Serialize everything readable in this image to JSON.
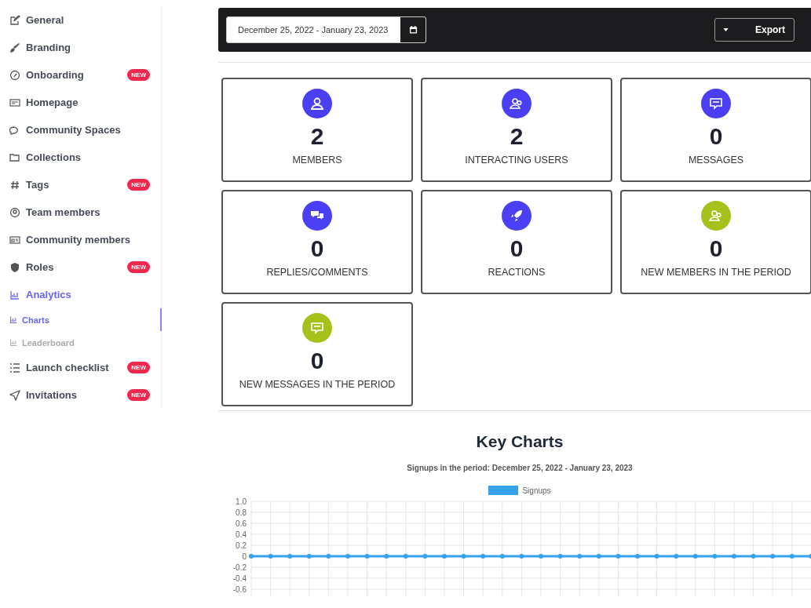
{
  "sidebar": {
    "items": [
      {
        "label": "General",
        "selected": false
      },
      {
        "label": "Branding",
        "selected": false
      },
      {
        "label": "Onboarding",
        "selected": false,
        "badge": "NEW"
      },
      {
        "label": "Homepage",
        "selected": false
      },
      {
        "label": "Community Spaces",
        "selected": false
      },
      {
        "label": "Collections",
        "selected": false
      },
      {
        "label": "Tags",
        "selected": false,
        "badge": "NEW"
      },
      {
        "label": "Team members",
        "selected": false
      },
      {
        "label": "Community members",
        "selected": false
      },
      {
        "label": "Roles",
        "selected": false,
        "badge": "NEW"
      },
      {
        "label": "Analytics",
        "selected": true,
        "children": [
          {
            "label": "Charts",
            "selected": true
          },
          {
            "label": "Leaderboard",
            "selected": false
          }
        ]
      },
      {
        "label": "Launch checklist",
        "selected": false,
        "badge": "NEW"
      },
      {
        "label": "Invitations",
        "selected": false,
        "badge": "NEW"
      }
    ]
  },
  "toolbar": {
    "date_range": "December 25, 2022 - January 23, 2023",
    "export_button": "Export"
  },
  "stats": [
    {
      "value": "2",
      "label": "MEMBERS",
      "color": "#4a3ff2"
    },
    {
      "value": "2",
      "label": "INTERACTING USERS",
      "color": "#4a3ff2"
    },
    {
      "value": "0",
      "label": "MESSAGES",
      "color": "#4a3ff2"
    },
    {
      "value": "0",
      "label": "REPLIES/COMMENTS",
      "color": "#4a3ff2"
    },
    {
      "value": "0",
      "label": "REACTIONS",
      "color": "#4a3ff2"
    },
    {
      "value": "0",
      "label": "NEW MEMBERS IN THE PERIOD",
      "color": "#a7c11c"
    },
    {
      "value": "0",
      "label": "NEW MESSAGES IN THE PERIOD",
      "color": "#a7c11c"
    }
  ],
  "key_charts": {
    "heading": "Key Charts",
    "chart_data": {
      "type": "line",
      "title": "Signups in the period: December 25, 2022 - January 23, 2023",
      "grid": true,
      "series": [
        {
          "name": "Signups",
          "color": "#36a2eb",
          "marker": true,
          "values": [
            0,
            0,
            0,
            0,
            0,
            0,
            0,
            0,
            0,
            0,
            0,
            0,
            0,
            0,
            0,
            0,
            0,
            0,
            0,
            0,
            0,
            0,
            0,
            0,
            0,
            0,
            0,
            0,
            0,
            0
          ]
        }
      ],
      "ylim": [
        -0.6,
        1.0
      ],
      "yticks": [
        {
          "value": 1,
          "label": "1.0"
        },
        0.8,
        0.6,
        0.4,
        0.2,
        0,
        -0.2,
        -0.4,
        -0.6
      ]
    }
  }
}
